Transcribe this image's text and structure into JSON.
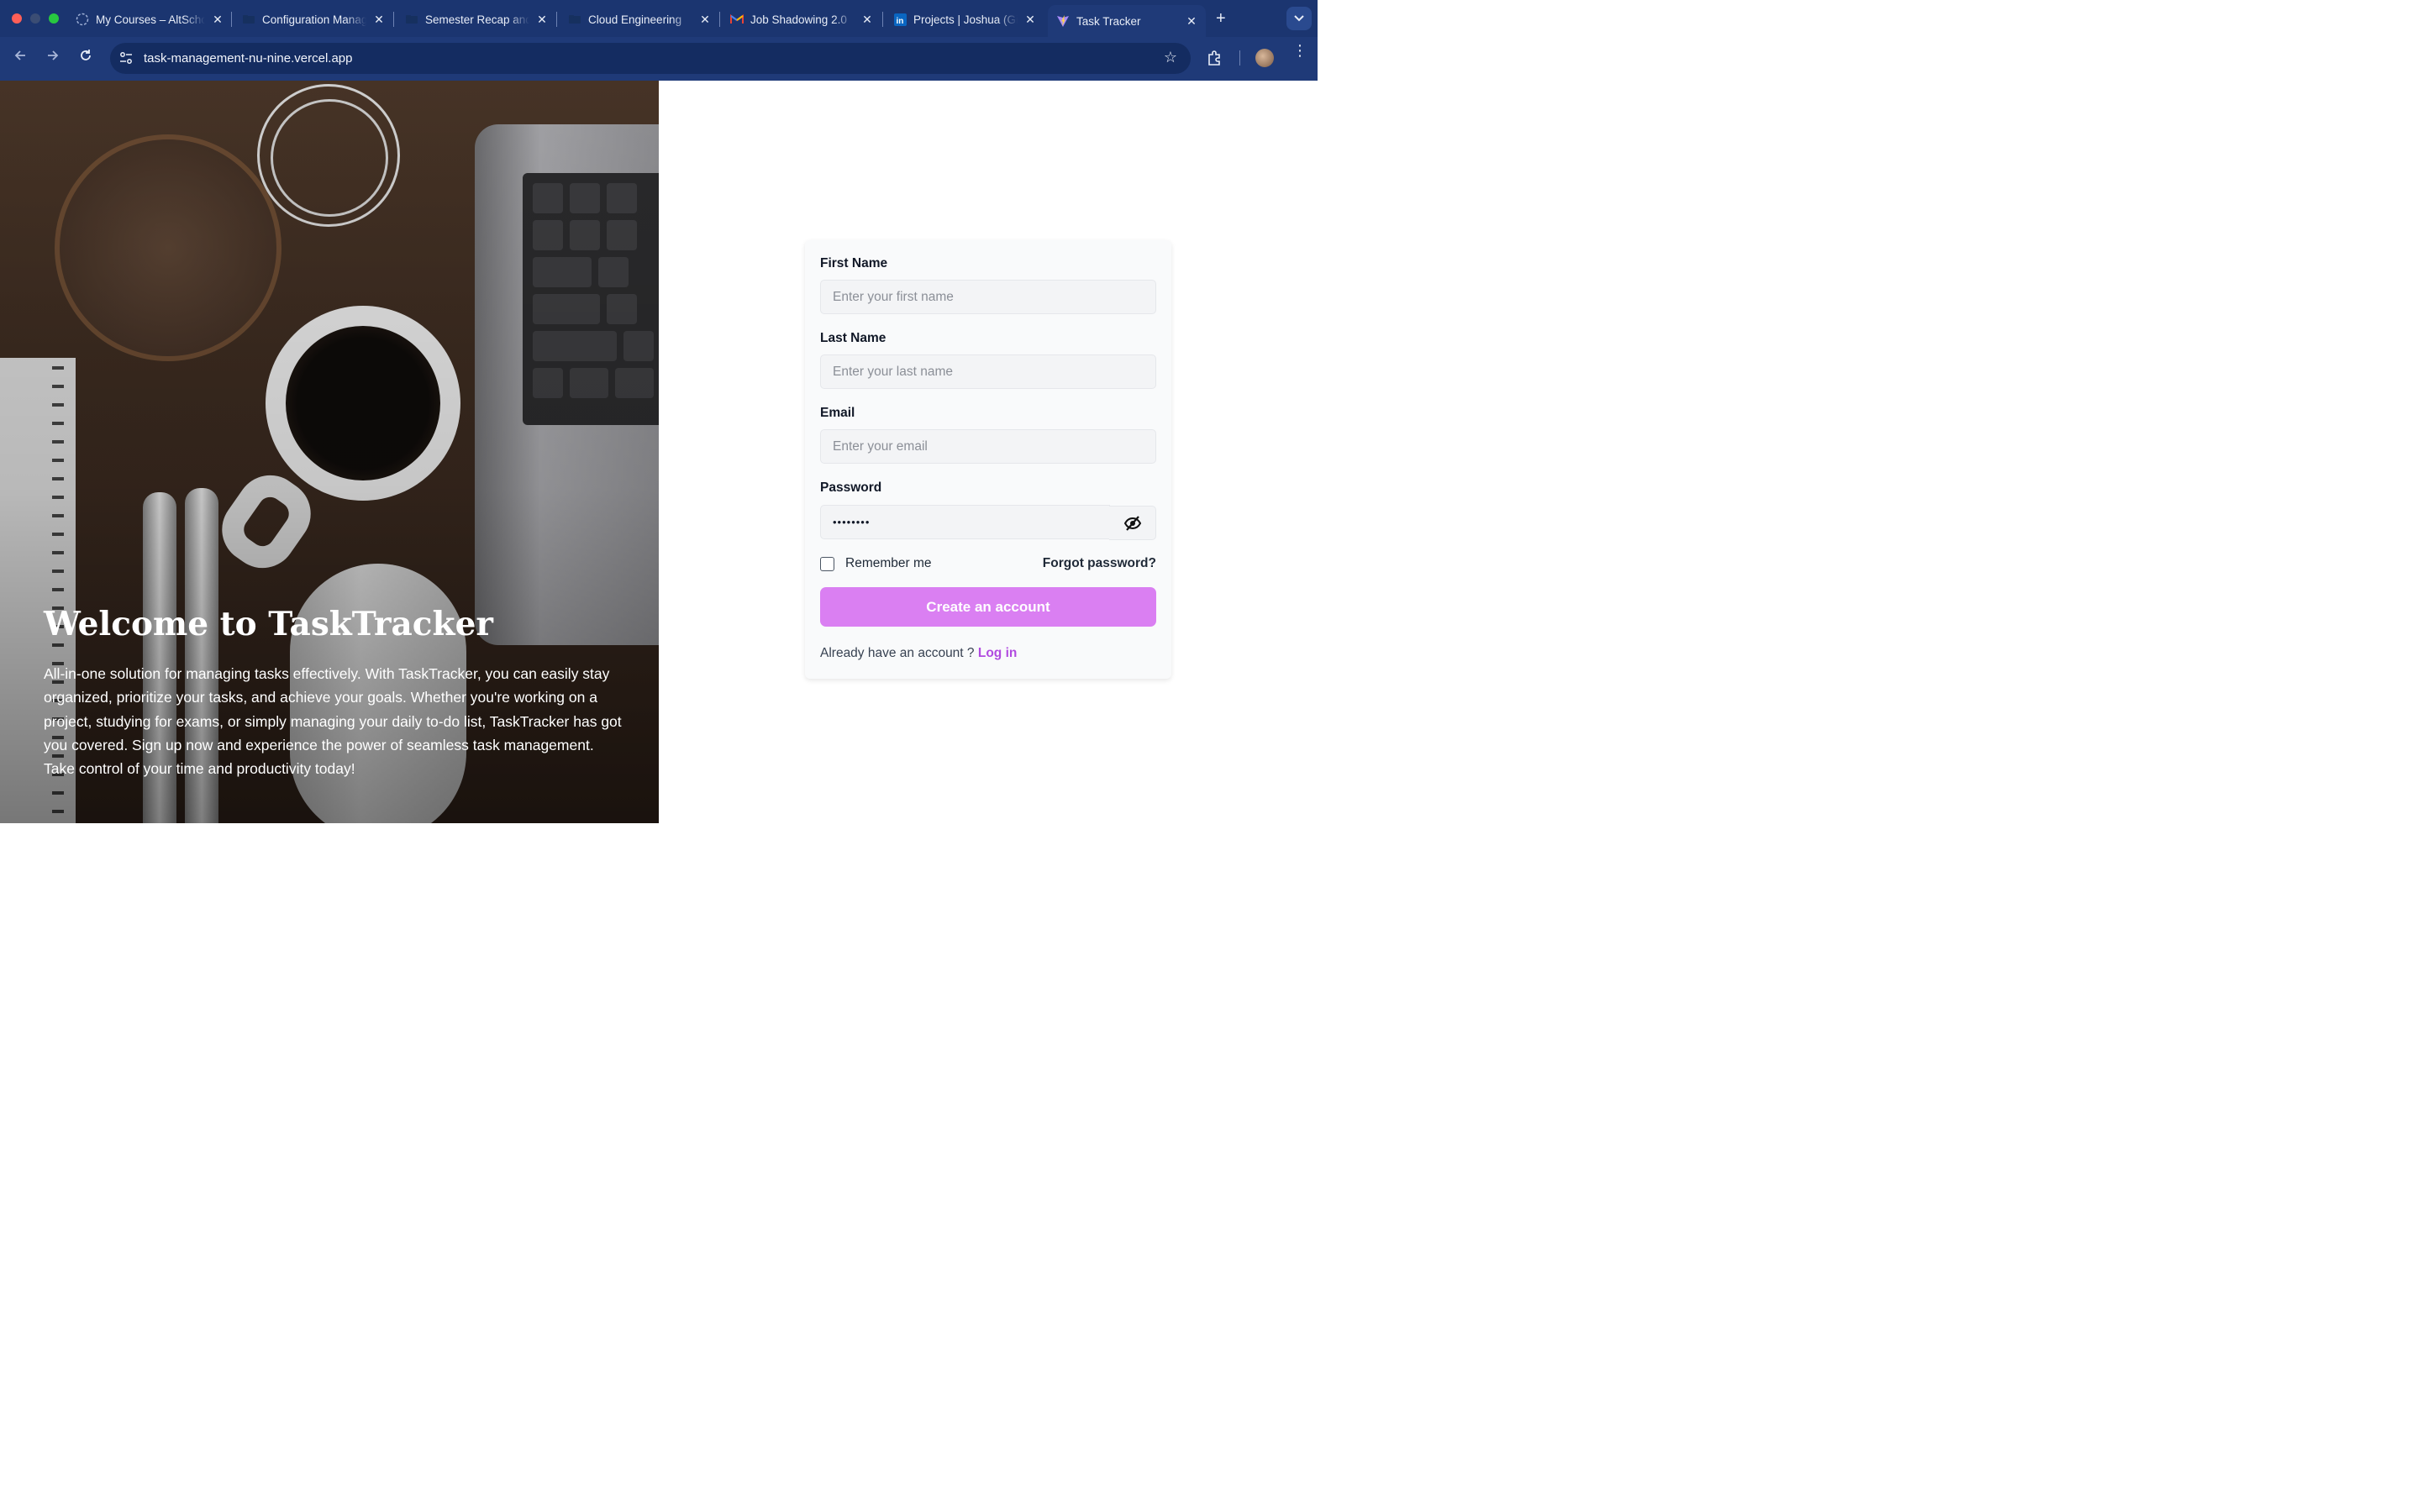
{
  "browser": {
    "tabs": [
      {
        "title": "My Courses – AltSchool"
      },
      {
        "title": "Configuration Management"
      },
      {
        "title": "Semester Recap and"
      },
      {
        "title": "Cloud Engineering"
      },
      {
        "title": "Job Shadowing 2.0"
      },
      {
        "title": "Projects | Joshua (GitHub)"
      },
      {
        "title": "Task Tracker",
        "active": true
      }
    ],
    "url": "task-management-nu-nine.vercel.app"
  },
  "hero": {
    "title": "Welcome to TaskTracker",
    "description": "All-in-one solution for managing tasks effectively. With TaskTracker, you can easily stay organized, prioritize your tasks, and achieve your goals. Whether you're working on a project, studying for exams, or simply managing your daily to-do list, TaskTracker has got you covered. Sign up now and experience the power of seamless task management. Take control of your time and productivity today!"
  },
  "form": {
    "first_name": {
      "label": "First Name",
      "placeholder": "Enter your first name",
      "value": ""
    },
    "last_name": {
      "label": "Last Name",
      "placeholder": "Enter your last name",
      "value": ""
    },
    "email": {
      "label": "Email",
      "placeholder": "Enter your email",
      "value": ""
    },
    "password": {
      "label": "Password",
      "value": "••••••••"
    },
    "remember_label": "Remember me",
    "forgot_label": "Forgot password?",
    "submit_label": "Create an account",
    "login_prompt": "Already have an account ?",
    "login_link": "Log in"
  },
  "colors": {
    "browser_bg": "#1f3a78",
    "button": "#da7ff2",
    "link": "#b14be0"
  }
}
